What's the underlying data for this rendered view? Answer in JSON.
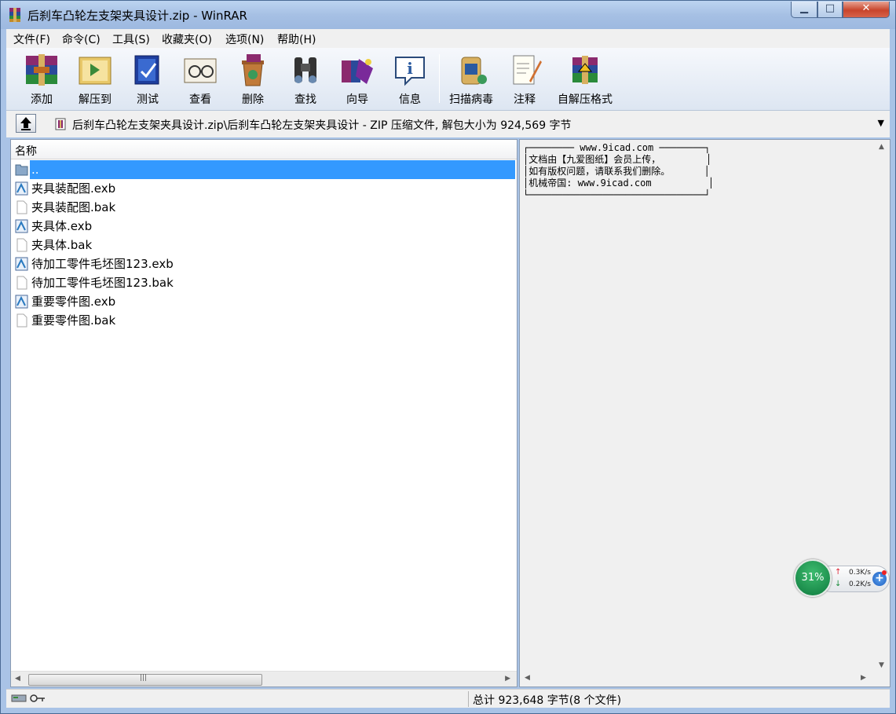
{
  "window": {
    "title": "后刹车凸轮左支架夹具设计.zip - WinRAR",
    "min_glyph": "▁",
    "max_glyph": "□",
    "close_glyph": "✕"
  },
  "menu": [
    {
      "label": "文件(F)"
    },
    {
      "label": "命令(C)"
    },
    {
      "label": "工具(S)"
    },
    {
      "label": "收藏夹(O)"
    },
    {
      "label": "选项(N)"
    },
    {
      "label": "帮助(H)"
    }
  ],
  "toolbar": [
    {
      "label": "添加",
      "icon": "add-archive-icon"
    },
    {
      "label": "解压到",
      "icon": "extract-to-icon"
    },
    {
      "label": "测试",
      "icon": "test-icon"
    },
    {
      "label": "查看",
      "icon": "view-icon"
    },
    {
      "label": "删除",
      "icon": "delete-icon"
    },
    {
      "label": "查找",
      "icon": "find-icon"
    },
    {
      "label": "向导",
      "icon": "wizard-icon"
    },
    {
      "label": "信息",
      "icon": "info-icon"
    },
    {
      "label": "扫描病毒",
      "icon": "virus-scan-icon"
    },
    {
      "label": "注释",
      "icon": "comment-icon"
    },
    {
      "label": "自解压格式",
      "icon": "sfx-icon"
    }
  ],
  "address": {
    "path": "后刹车凸轮左支架夹具设计.zip\\后刹车凸轮左支架夹具设计 - ZIP 压缩文件, 解包大小为 924,569 字节"
  },
  "file_list": {
    "column_name": "名称",
    "rows": [
      {
        "name": "..",
        "type": "folder-up"
      },
      {
        "name": "夹具装配图.exb",
        "type": "exb"
      },
      {
        "name": "夹具装配图.bak",
        "type": "bak"
      },
      {
        "name": "夹具体.exb",
        "type": "exb"
      },
      {
        "name": "夹具体.bak",
        "type": "bak"
      },
      {
        "name": "待加工零件毛坯图123.exb",
        "type": "exb"
      },
      {
        "name": "待加工零件毛坯图123.bak",
        "type": "bak"
      },
      {
        "name": "重要零件图.exb",
        "type": "exb"
      },
      {
        "name": "重要零件图.bak",
        "type": "bak"
      }
    ]
  },
  "comment": {
    "lines": [
      "┌──────── www.9icad.com ────────┐",
      "│文档由【九爱图纸】会员上传，        │",
      "│如有版权问题，请联系我们删除。      │",
      "│机械帝国: www.9icad.com          │",
      "└───────────────────────────────┘"
    ]
  },
  "net_widget": {
    "percent": "31%",
    "upload": "0.3K/s",
    "download": "0.2K/s"
  },
  "status": {
    "summary": "总计 923,648 字节(8 个文件)"
  },
  "colors": {
    "selection": "#3399ff",
    "title_bg": "#a9c3e6"
  }
}
